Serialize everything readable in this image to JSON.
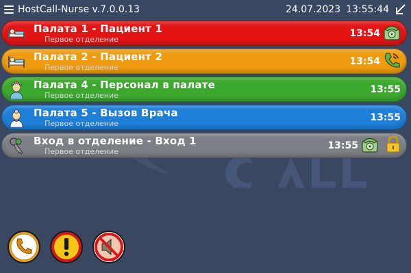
{
  "header": {
    "app_title": "HostCall-Nurse v.7.0.0.13",
    "date": "24.07.2023",
    "time": "13:55:44"
  },
  "calls": [
    {
      "title": "Палата 1 - Пациент 1",
      "subtitle": "Первое отделение",
      "time": "13:54",
      "color": "#e31414",
      "icon": "patient-bed-icon",
      "status_icon": "phone-icon"
    },
    {
      "title": "Палата 2 - Пациент 2",
      "subtitle": "Первое отделение",
      "time": "13:54",
      "color": "#ee9b10",
      "icon": "patient-bed-icon",
      "status_icon": "phone-call-icon"
    },
    {
      "title": "Палата 4 - Персонал в палате",
      "subtitle": "Первое отделение",
      "time": "13:55",
      "color": "#3ca92e",
      "icon": "nurse-icon",
      "status_icon": ""
    },
    {
      "title": "Палата 5 - Вызов Врача",
      "subtitle": "Первое отделение",
      "time": "13:55",
      "color": "#1e7fd8",
      "icon": "doctor-icon",
      "status_icon": ""
    },
    {
      "title": "Вход в отделение - Вход 1",
      "subtitle": "Первое отделение",
      "time": "13:55",
      "color": "#7c7f85",
      "icon": "keys-icon",
      "status_icon": "phone-icon",
      "extra_icon": "lock-icon"
    }
  ],
  "bottom_buttons": [
    {
      "icon": "phone-icon",
      "color": "#e8a520"
    },
    {
      "icon": "alert-icon",
      "color": "#f0c020"
    },
    {
      "icon": "mute-icon",
      "color": "#d31a1a"
    }
  ]
}
